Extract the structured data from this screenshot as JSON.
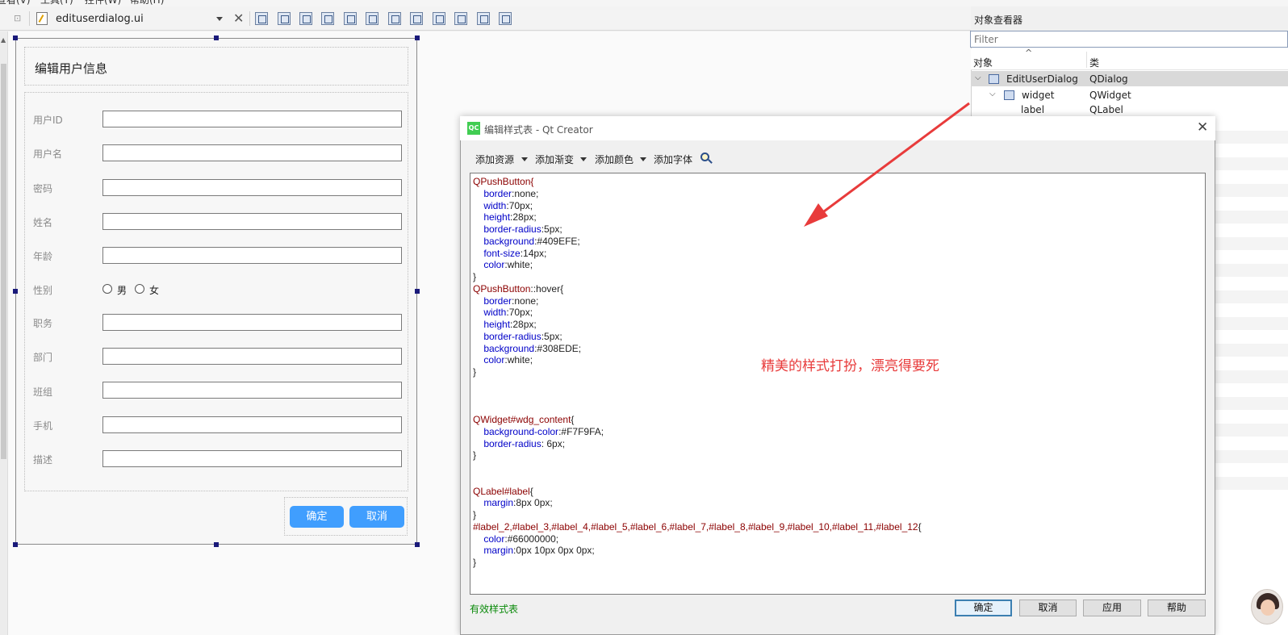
{
  "menubar": [
    "查看(V)",
    "工具(T)",
    "控件(W)",
    "帮助(H)"
  ],
  "toolbar": {
    "filename": "edituserdialog.ui"
  },
  "form": {
    "title": "编辑用户信息",
    "fields": [
      "用户ID",
      "用户名",
      "密码",
      "姓名",
      "年龄"
    ],
    "gender_label": "性别",
    "gender_options": [
      "男",
      "女"
    ],
    "fields2": [
      "职务",
      "部门",
      "班组",
      "手机",
      "描述"
    ],
    "ok": "确定",
    "cancel": "取消"
  },
  "inspector": {
    "title": "对象查看器",
    "filter_placeholder": "Filter",
    "col_object": "对象",
    "col_class": "类",
    "rows": [
      {
        "name": "EditUserDialog",
        "class": "QDialog"
      },
      {
        "name": "widget",
        "class": "QWidget"
      },
      {
        "name": "label",
        "class": "QLabel"
      }
    ]
  },
  "style_dialog": {
    "title": "编辑样式表 - Qt Creator",
    "icon_text": "QC",
    "menus": [
      "添加资源",
      "添加渐变",
      "添加颜色",
      "添加字体"
    ],
    "valid_text": "有效样式表",
    "buttons": [
      "确定",
      "取消",
      "应用",
      "帮助"
    ],
    "code_lines": [
      [
        [
          "k",
          "QPushButton{"
        ]
      ],
      [
        [
          "p",
          "    border"
        ],
        [
          "t",
          ":none;"
        ]
      ],
      [
        [
          "p",
          "    width"
        ],
        [
          "t",
          ":70px;"
        ]
      ],
      [
        [
          "p",
          "    height"
        ],
        [
          "t",
          ":28px;"
        ]
      ],
      [
        [
          "p",
          "    border-radius"
        ],
        [
          "t",
          ":5px;"
        ]
      ],
      [
        [
          "p",
          "    background"
        ],
        [
          "t",
          ":#409EFE;"
        ]
      ],
      [
        [
          "p",
          "    font-size"
        ],
        [
          "t",
          ":14px;"
        ]
      ],
      [
        [
          "p",
          "    color"
        ],
        [
          "t",
          ":white;"
        ]
      ],
      [
        [
          "t",
          "}"
        ]
      ],
      [
        [
          "k",
          "QPushButton"
        ],
        [
          "t",
          "::hover{"
        ]
      ],
      [
        [
          "p",
          "    border"
        ],
        [
          "t",
          ":none;"
        ]
      ],
      [
        [
          "p",
          "    width"
        ],
        [
          "t",
          ":70px;"
        ]
      ],
      [
        [
          "p",
          "    height"
        ],
        [
          "t",
          ":28px;"
        ]
      ],
      [
        [
          "p",
          "    border-radius"
        ],
        [
          "t",
          ":5px;"
        ]
      ],
      [
        [
          "p",
          "    background"
        ],
        [
          "t",
          ":#308EDE;"
        ]
      ],
      [
        [
          "p",
          "    color"
        ],
        [
          "t",
          ":white;"
        ]
      ],
      [
        [
          "t",
          "}"
        ]
      ],
      [],
      [],
      [],
      [
        [
          "k",
          "QWidget#wdg_content"
        ],
        [
          "t",
          "{"
        ]
      ],
      [
        [
          "p",
          "    background-color"
        ],
        [
          "t",
          ":#F7F9FA;"
        ]
      ],
      [
        [
          "p",
          "    border-radius"
        ],
        [
          "t",
          ": 6px;"
        ]
      ],
      [
        [
          "t",
          "}"
        ]
      ],
      [],
      [],
      [
        [
          "k",
          "QLabel#label"
        ],
        [
          "t",
          "{"
        ]
      ],
      [
        [
          "p",
          "    margin"
        ],
        [
          "t",
          ":8px 0px;"
        ]
      ],
      [
        [
          "t",
          "}"
        ]
      ],
      [
        [
          "k",
          "#label_2,#label_3,#label_4,#label_5,#label_6,#label_7,#label_8,#label_9,#label_10,#label_11,#label_12"
        ],
        [
          "t",
          "{"
        ]
      ],
      [
        [
          "p",
          "    color"
        ],
        [
          "t",
          ":#66000000;"
        ]
      ],
      [
        [
          "p",
          "    margin"
        ],
        [
          "t",
          ":0px 10px 0px 0px;"
        ]
      ],
      [
        [
          "t",
          "}"
        ]
      ]
    ]
  },
  "annotation": "精美的样式打扮，漂亮得要死",
  "colors": {
    "button_blue": "#409EFE",
    "annotation_red": "#E83B3B",
    "selector": "#8B0000",
    "property": "#0000C8"
  }
}
